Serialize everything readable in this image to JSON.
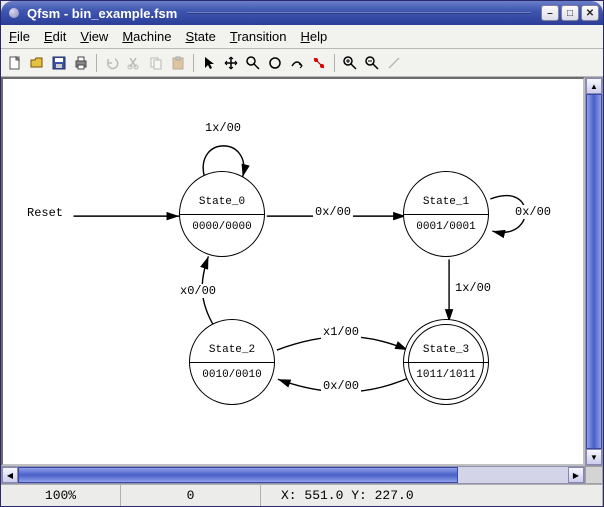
{
  "title": "Qfsm - bin_example.fsm",
  "menus": {
    "file": "File",
    "edit": "Edit",
    "view": "View",
    "machine": "Machine",
    "state": "State",
    "transition": "Transition",
    "help": "Help"
  },
  "toolbar_icons": {
    "new": "new-file-icon",
    "open": "open-file-icon",
    "save": "save-icon",
    "print": "print-icon",
    "undo": "undo-icon",
    "cut": "cut-icon",
    "copy": "copy-icon",
    "paste": "paste-icon",
    "select": "pointer-icon",
    "pan": "pan-icon",
    "zoom": "magnifier-icon",
    "new_state": "new-state-icon",
    "new_transition": "new-transition-icon",
    "simulate": "simulate-icon",
    "zoom_in": "zoom-in-icon",
    "zoom_out": "zoom-out-icon",
    "line": "line-tool-icon"
  },
  "diagram": {
    "reset_label": "Reset",
    "states": {
      "s0": {
        "name": "State_0",
        "code": "0000/0000"
      },
      "s1": {
        "name": "State_1",
        "code": "0001/0001"
      },
      "s2": {
        "name": "State_2",
        "code": "0010/0010"
      },
      "s3": {
        "name": "State_3",
        "code": "1011/1011"
      }
    },
    "transitions": {
      "s0_self": "1x/00",
      "s0_s1": "0x/00",
      "s1_self": "0x/00",
      "s1_s3": "1x/00",
      "s2_s0": "x0/00",
      "s2_s3": "x1/00",
      "s3_s2": "0x/00"
    }
  },
  "status": {
    "zoom": "100%",
    "selection": "0",
    "coords": "X:  551.0  Y:  227.0"
  }
}
